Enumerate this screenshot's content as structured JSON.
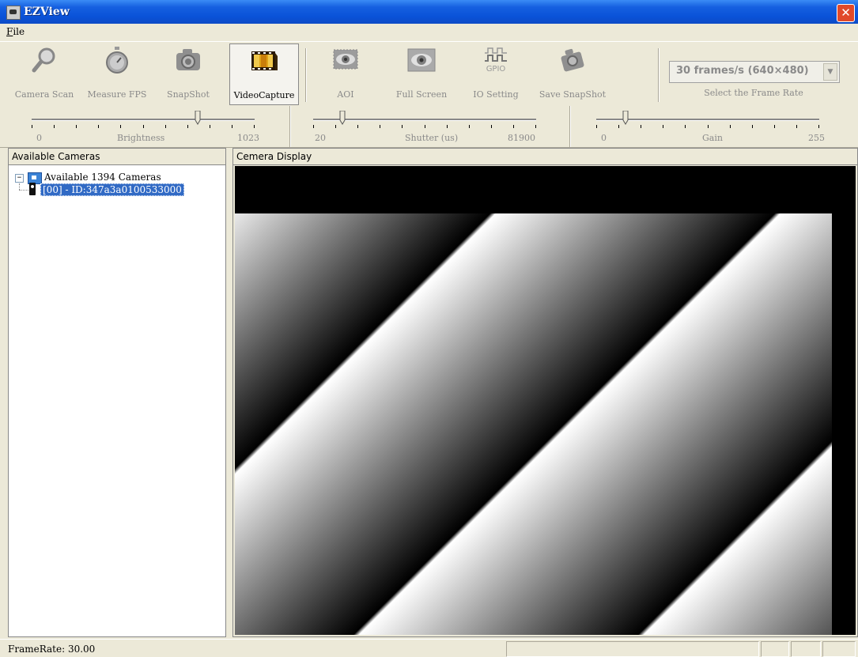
{
  "window": {
    "title": "EZView",
    "close_glyph": "✕"
  },
  "menu": {
    "file": "File"
  },
  "toolbar": {
    "buttons": [
      {
        "label": "Camera Scan",
        "icon": "magnifier-icon",
        "enabled": false
      },
      {
        "label": "Measure FPS",
        "icon": "stopwatch-icon",
        "enabled": false
      },
      {
        "label": "SnapShot",
        "icon": "camera-icon",
        "enabled": false
      },
      {
        "label": "VideoCapture",
        "icon": "film-reel-icon",
        "enabled": true
      },
      {
        "label": "AOI",
        "icon": "eye-aoi-icon",
        "enabled": false
      },
      {
        "label": "Full Screen",
        "icon": "eye-fullscreen-icon",
        "enabled": false
      },
      {
        "label": "IO Setting",
        "icon": "gpio-icon",
        "enabled": false
      },
      {
        "label": "Save SnapShot",
        "icon": "save-camera-icon",
        "enabled": false
      }
    ],
    "gpio_text": "GPIO",
    "frame_rate": {
      "value": "30 frames/s (640×480)",
      "caption": "Select the Frame Rate",
      "arrow": "▼"
    }
  },
  "sliders": [
    {
      "name": "Brightness",
      "min": "0",
      "max": "1023",
      "position": 0.75
    },
    {
      "name": "Shutter (us)",
      "min": "20",
      "max": "81900",
      "position": 0.12
    },
    {
      "name": "Gain",
      "min": "0",
      "max": "255",
      "position": 0.12
    }
  ],
  "left_panel": {
    "title": "Available Cameras",
    "tree": {
      "root": "Available 1394 Cameras",
      "expander": "−",
      "children": [
        "[00] - ID:347a3a0100533000"
      ]
    }
  },
  "right_panel": {
    "title": "Cemera Display"
  },
  "status": {
    "framerate": "FrameRate: 30.00"
  },
  "colors": {
    "title_bar": "#0a52d8",
    "selection": "#316ac5",
    "face": "#ece9d8"
  }
}
